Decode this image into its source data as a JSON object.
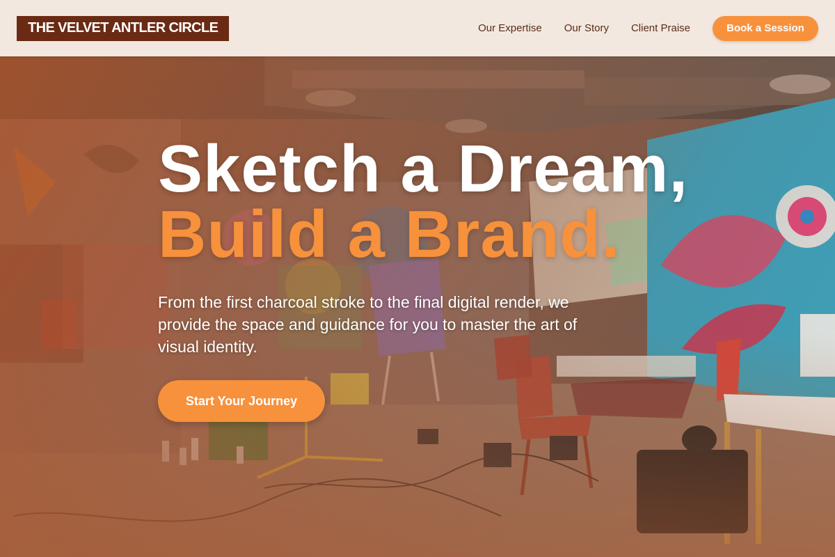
{
  "header": {
    "logo_text": "THE VELVET ANTLER CIRCLE",
    "nav": [
      {
        "label": "Our Expertise"
      },
      {
        "label": "Our Story"
      },
      {
        "label": "Client Praise"
      }
    ],
    "cta_label": "Book a Session"
  },
  "hero": {
    "headline_line1": "Sketch a Dream,",
    "headline_line2": "Build a Brand.",
    "subtext": "From the first charcoal stroke to the final digital render, we provide the space and guidance for you to master the art of visual identity.",
    "cta_label": "Start Your Journey",
    "background_image": "graffiti art studio with easels, chairs, and a sugar skull mural"
  },
  "colors": {
    "accent": "#f7913c",
    "logo_bg": "#6a2a14",
    "header_bg": "#f2e8df",
    "nav_text": "#5a2c18"
  }
}
